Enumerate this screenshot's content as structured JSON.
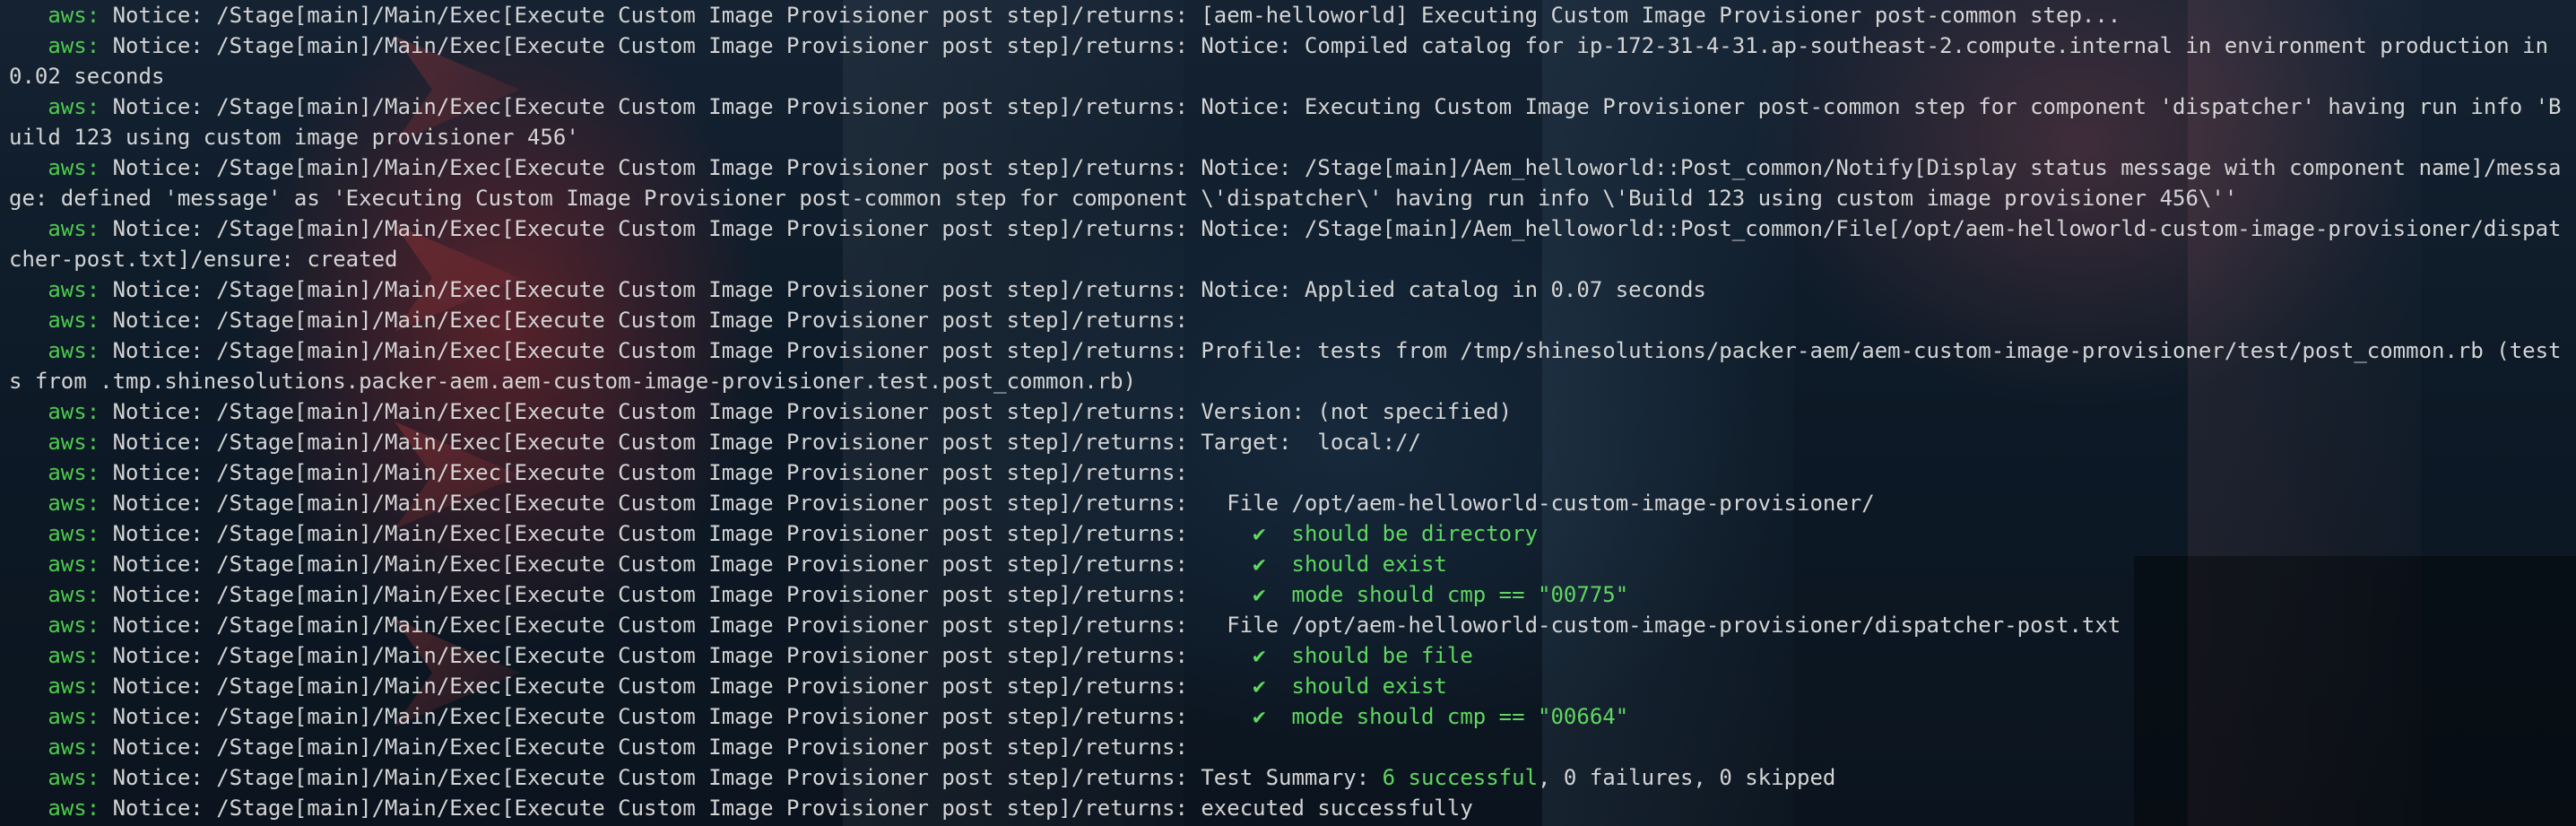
{
  "theme": {
    "text_color": "#d4d4d4",
    "prefix_color": "#4ec94e",
    "success_color": "#5fd75f",
    "background": "#0d1620"
  },
  "log": {
    "lines": [
      {
        "prefix": "aws:",
        "parts": [
          {
            "text": " Notice: /Stage[main]/Main/Exec[Execute Custom Image Provisioner post step]/returns: [aem-helloworld] Executing Custom Image Provisioner post-common step..."
          }
        ]
      },
      {
        "prefix": "aws:",
        "parts": [
          {
            "text": " Notice: /Stage[main]/Main/Exec[Execute Custom Image Provisioner post step]/returns: Notice: Compiled catalog for ip-172-31-4-31.ap-southeast-2.compute.internal in environment production in 0.02 seconds"
          }
        ]
      },
      {
        "prefix": "aws:",
        "parts": [
          {
            "text": " Notice: /Stage[main]/Main/Exec[Execute Custom Image Provisioner post step]/returns: Notice: Executing Custom Image Provisioner post-common step for component 'dispatcher' having run info 'Build 123 using custom image provisioner 456'"
          }
        ]
      },
      {
        "prefix": "aws:",
        "parts": [
          {
            "text": " Notice: /Stage[main]/Main/Exec[Execute Custom Image Provisioner post step]/returns: Notice: /Stage[main]/Aem_helloworld::Post_common/Notify[Display status message with component name]/message: defined 'message' as 'Executing Custom Image Provisioner post-common step for component \\'dispatcher\\' having run info \\'Build 123 using custom image provisioner 456\\''"
          }
        ]
      },
      {
        "prefix": "aws:",
        "parts": [
          {
            "text": " Notice: /Stage[main]/Main/Exec[Execute Custom Image Provisioner post step]/returns: Notice: /Stage[main]/Aem_helloworld::Post_common/File[/opt/aem-helloworld-custom-image-provisioner/dispatcher-post.txt]/ensure: created"
          }
        ]
      },
      {
        "prefix": "aws:",
        "parts": [
          {
            "text": " Notice: /Stage[main]/Main/Exec[Execute Custom Image Provisioner post step]/returns: Notice: Applied catalog in 0.07 seconds"
          }
        ]
      },
      {
        "prefix": "aws:",
        "parts": [
          {
            "text": " Notice: /Stage[main]/Main/Exec[Execute Custom Image Provisioner post step]/returns:"
          }
        ]
      },
      {
        "prefix": "aws:",
        "parts": [
          {
            "text": " Notice: /Stage[main]/Main/Exec[Execute Custom Image Provisioner post step]/returns: Profile: tests from /tmp/shinesolutions/packer-aem/aem-custom-image-provisioner/test/post_common.rb (tests from .tmp.shinesolutions.packer-aem.aem-custom-image-provisioner.test.post_common.rb)"
          }
        ]
      },
      {
        "prefix": "aws:",
        "parts": [
          {
            "text": " Notice: /Stage[main]/Main/Exec[Execute Custom Image Provisioner post step]/returns: Version: (not specified)"
          }
        ]
      },
      {
        "prefix": "aws:",
        "parts": [
          {
            "text": " Notice: /Stage[main]/Main/Exec[Execute Custom Image Provisioner post step]/returns: Target:  local://"
          }
        ]
      },
      {
        "prefix": "aws:",
        "parts": [
          {
            "text": " Notice: /Stage[main]/Main/Exec[Execute Custom Image Provisioner post step]/returns:"
          }
        ]
      },
      {
        "prefix": "aws:",
        "parts": [
          {
            "text": " Notice: /Stage[main]/Main/Exec[Execute Custom Image Provisioner post step]/returns:   File /opt/aem-helloworld-custom-image-provisioner/"
          }
        ]
      },
      {
        "prefix": "aws:",
        "parts": [
          {
            "text": " Notice: /Stage[main]/Main/Exec[Execute Custom Image Provisioner post step]/returns:     "
          },
          {
            "text": "✔  should be directory",
            "style": "check"
          }
        ]
      },
      {
        "prefix": "aws:",
        "parts": [
          {
            "text": " Notice: /Stage[main]/Main/Exec[Execute Custom Image Provisioner post step]/returns:     "
          },
          {
            "text": "✔  should exist",
            "style": "check"
          }
        ]
      },
      {
        "prefix": "aws:",
        "parts": [
          {
            "text": " Notice: /Stage[main]/Main/Exec[Execute Custom Image Provisioner post step]/returns:     "
          },
          {
            "text": "✔  mode should cmp == \"00775\"",
            "style": "check"
          }
        ]
      },
      {
        "prefix": "aws:",
        "parts": [
          {
            "text": " Notice: /Stage[main]/Main/Exec[Execute Custom Image Provisioner post step]/returns:   File /opt/aem-helloworld-custom-image-provisioner/dispatcher-post.txt"
          }
        ]
      },
      {
        "prefix": "aws:",
        "parts": [
          {
            "text": " Notice: /Stage[main]/Main/Exec[Execute Custom Image Provisioner post step]/returns:     "
          },
          {
            "text": "✔  should be file",
            "style": "check"
          }
        ]
      },
      {
        "prefix": "aws:",
        "parts": [
          {
            "text": " Notice: /Stage[main]/Main/Exec[Execute Custom Image Provisioner post step]/returns:     "
          },
          {
            "text": "✔  should exist",
            "style": "check"
          }
        ]
      },
      {
        "prefix": "aws:",
        "parts": [
          {
            "text": " Notice: /Stage[main]/Main/Exec[Execute Custom Image Provisioner post step]/returns:     "
          },
          {
            "text": "✔  mode should cmp == \"00664\"",
            "style": "check"
          }
        ]
      },
      {
        "prefix": "aws:",
        "parts": [
          {
            "text": " Notice: /Stage[main]/Main/Exec[Execute Custom Image Provisioner post step]/returns:"
          }
        ]
      },
      {
        "prefix": "aws:",
        "parts": [
          {
            "text": " Notice: /Stage[main]/Main/Exec[Execute Custom Image Provisioner post step]/returns: Test Summary: "
          },
          {
            "text": "6 successful",
            "style": "green"
          },
          {
            "text": ", 0 failures, 0 skipped"
          }
        ]
      },
      {
        "prefix": "aws:",
        "parts": [
          {
            "text": " Notice: /Stage[main]/Main/Exec[Execute Custom Image Provisioner post step]/returns: executed successfully"
          }
        ]
      }
    ]
  }
}
